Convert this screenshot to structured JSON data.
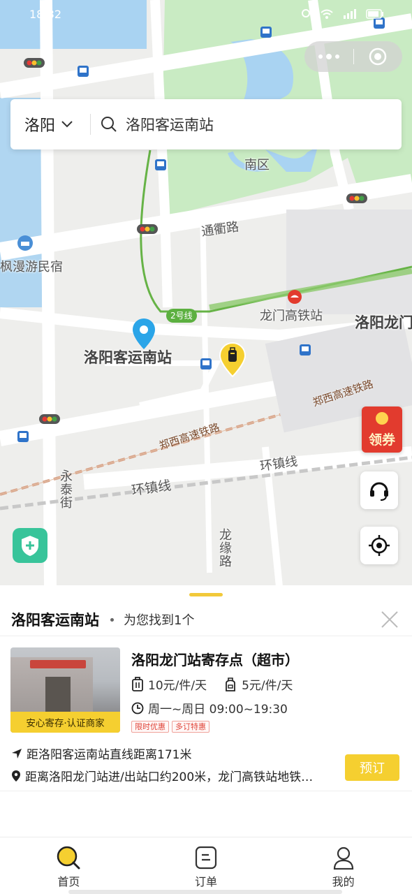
{
  "status_bar": {
    "time": "18:32",
    "battery": ""
  },
  "capsule": {
    "more_icon": "more-dots-icon",
    "close_icon": "target-circle-icon"
  },
  "search": {
    "city": "洛阳",
    "query": "洛阳客运南站"
  },
  "map": {
    "labels": {
      "south_district": "南区",
      "tongqu_road": "通衢路",
      "hostel": "枫漫游民宿",
      "longmen_station": "龙门高铁站",
      "luoyang_longmen": "洛阳龙门",
      "bus_station": "洛阳客运南站",
      "line2": "2号线",
      "zhengxi_rail_1": "郑西高速铁路",
      "zhengxi_rail_2": "郑西高速铁路",
      "huanzhen_line_1": "环镇线",
      "huanzhen_line_2": "环镇线",
      "yongtai_street": "永泰街",
      "longyuan_road": "龙缘路"
    },
    "coupon_label": "领券",
    "colors": {
      "park": "#c9ebc3",
      "water": "#a9d3f2",
      "marker": "#2ba5e8",
      "accent": "#f5cf30"
    }
  },
  "sheet": {
    "title": "洛阳客运南站",
    "count_text": "为您找到1个",
    "result": {
      "name": "洛阳龙门站寄存点（超市）",
      "photo_tag": "安心寄存·认证商家",
      "price_large": "10元/件/天",
      "price_small": "5元/件/天",
      "hours": "周一~周日 09:00~19:30",
      "tags": [
        "限时优惠",
        "多订特惠"
      ],
      "distance": "距洛阳客运南站直线距离171米",
      "address": "距离洛阳龙门站进/出站口约200米，龙门高铁站地铁…",
      "book_label": "预订"
    }
  },
  "tabs": [
    {
      "label": "首页",
      "icon": "search-icon"
    },
    {
      "label": "订单",
      "icon": "order-icon"
    },
    {
      "label": "我的",
      "icon": "user-icon"
    }
  ]
}
